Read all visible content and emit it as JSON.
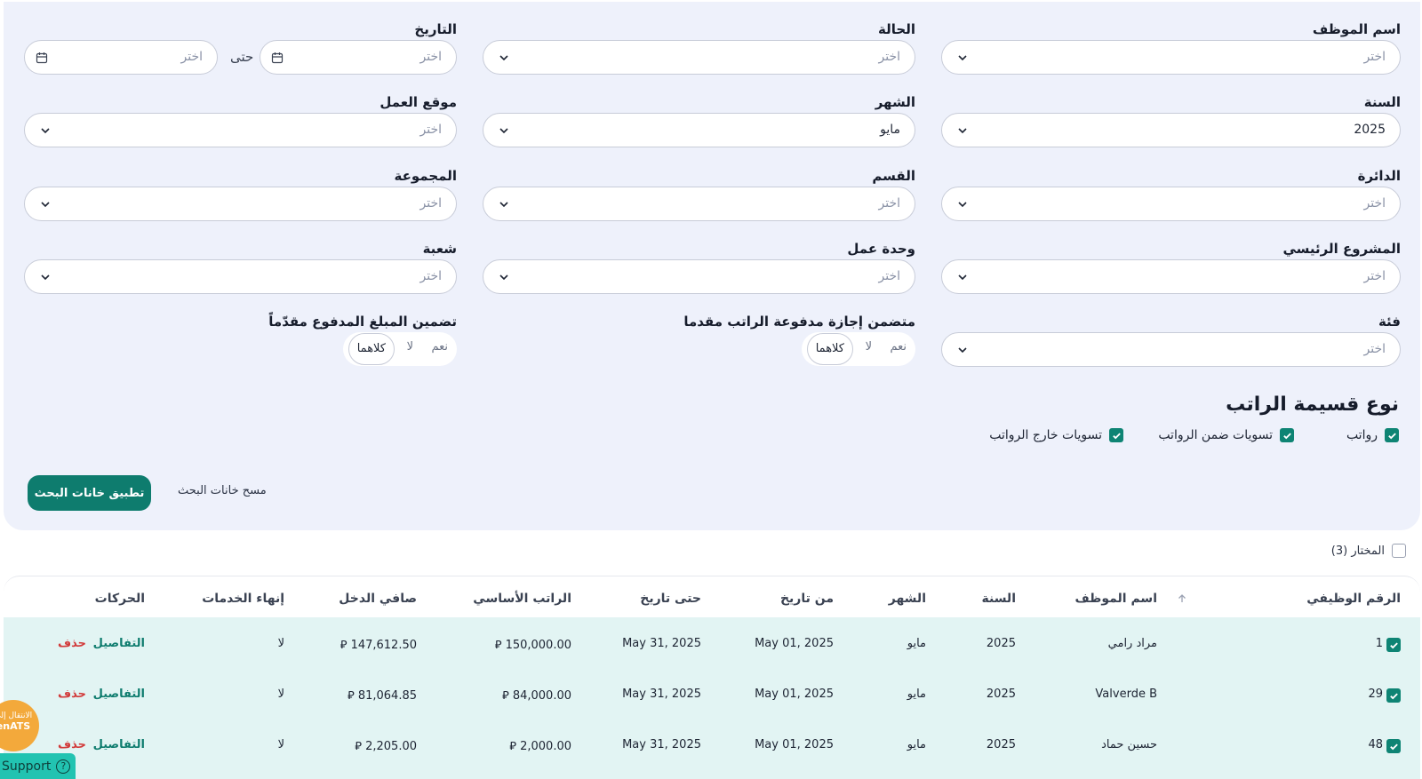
{
  "filters": {
    "placeholder": "اختر",
    "employee_name": {
      "label": "اسم الموظف"
    },
    "status": {
      "label": "الحالة"
    },
    "date": {
      "label": "التاريخ",
      "separator": "حتى"
    },
    "year": {
      "label": "السنة",
      "value": "2025"
    },
    "month": {
      "label": "الشهر",
      "value": "مايو"
    },
    "work_location": {
      "label": "موقع العمل"
    },
    "department": {
      "label": "الدائرة"
    },
    "section": {
      "label": "القسم"
    },
    "group": {
      "label": "المجموعة"
    },
    "main_project": {
      "label": "المشروع الرئيسي"
    },
    "work_unit": {
      "label": "وحدة عمل"
    },
    "division": {
      "label": "شعبة"
    },
    "category": {
      "label": "فئة"
    },
    "paid_leave_advance": {
      "label": "متضمن إجازة مدفوعة الراتب مقدما",
      "options": [
        "نعم",
        "لا",
        "كلاهما"
      ],
      "selected": "كلاهما"
    },
    "advance_amount": {
      "label": "تضمين المبلغ المدفوع مقدّماً",
      "options": [
        "نعم",
        "لا",
        "كلاهما"
      ],
      "selected": "كلاهما"
    }
  },
  "slip_type": {
    "title": "نوع قسيمة الراتب",
    "options": [
      {
        "label": "رواتب",
        "checked": true
      },
      {
        "label": "تسويات ضمن الرواتب",
        "checked": true
      },
      {
        "label": "تسويات خارج الرواتب",
        "checked": true
      }
    ]
  },
  "actions": {
    "apply": "تطبيق خانات البحث",
    "clear": "مسح خانات البحث"
  },
  "selection": {
    "label": "المختار (3)"
  },
  "table": {
    "headers": {
      "emp_no": "الرقم الوظيفي",
      "emp_name": "اسم الموظف",
      "year": "السنة",
      "month": "الشهر",
      "from_date": "من تاريخ",
      "to_date": "حتى تاريخ",
      "basic_salary": "الراتب الأساسي",
      "net_income": "صافي الدخل",
      "end_of_service": "إنهاء الخدمات",
      "actions": "الحركات"
    },
    "rows": [
      {
        "emp_no": "1",
        "emp_name": "مراد رامي",
        "year": "2025",
        "month": "مايو",
        "from_date": "May 01, 2025",
        "to_date": "May 31, 2025",
        "basic_salary": "150,000.00 ⃁",
        "net_income": "147,612.50 ⃁",
        "end_of_service": "لا",
        "details": "التفاصيل",
        "delete": "حذف"
      },
      {
        "emp_no": "29",
        "emp_name": "Valverde B",
        "year": "2025",
        "month": "مايو",
        "from_date": "May 01, 2025",
        "to_date": "May 31, 2025",
        "basic_salary": "84,000.00 ⃁",
        "net_income": "81,064.85 ⃁",
        "end_of_service": "لا",
        "details": "التفاصيل",
        "delete": "حذف"
      },
      {
        "emp_no": "48",
        "emp_name": "حسين حماد",
        "year": "2025",
        "month": "مايو",
        "from_date": "May 01, 2025",
        "to_date": "May 31, 2025",
        "basic_salary": "2,000.00 ⃁",
        "net_income": "2,205.00 ⃁",
        "end_of_service": "لا",
        "details": "التفاصيل",
        "delete": "حذف"
      }
    ]
  },
  "widgets": {
    "fab_line1": "الانتقال إلى",
    "fab_line2": "enATS",
    "support": "Support"
  },
  "colors": {
    "primary": "#0e7c6e",
    "panel_bg": "#eef1fb",
    "row_bg": "#e2f4f3",
    "delete": "#d23a3a",
    "fab": "#f3a93b",
    "support": "#22c3b1"
  }
}
